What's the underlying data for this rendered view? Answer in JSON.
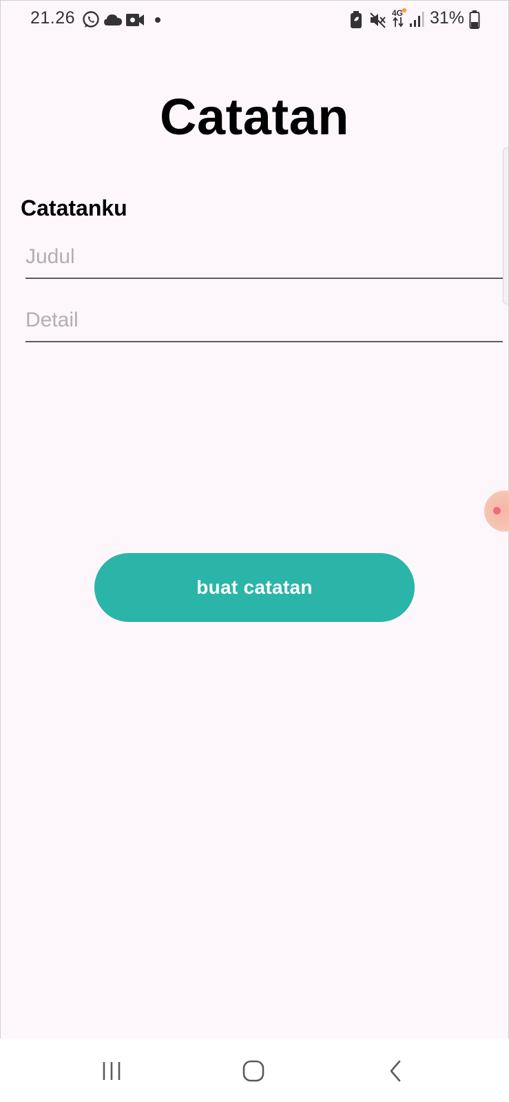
{
  "status_bar": {
    "time": "21.26",
    "battery_text": "31%",
    "icons": [
      "whatsapp-icon",
      "cloud-icon",
      "video-camera-icon",
      "dot-icon",
      "battery-saver-icon",
      "mute-icon",
      "4g-signal-icon",
      "signal-strength-icon",
      "battery-icon"
    ]
  },
  "page": {
    "title": "Catatan",
    "section_label": "Catatanku"
  },
  "form": {
    "title_placeholder": "Judul",
    "title_value": "",
    "detail_placeholder": "Detail",
    "detail_value": ""
  },
  "actions": {
    "create_label": "buat catatan"
  },
  "nav_bar": {
    "icons": [
      "recent-apps-icon",
      "home-icon",
      "back-icon"
    ]
  },
  "colors": {
    "background": "#fdf7fc",
    "button": "#2bb5a8",
    "button_text": "#ffffff",
    "placeholder": "#b2aeb5",
    "underline": "#5d5a60"
  }
}
